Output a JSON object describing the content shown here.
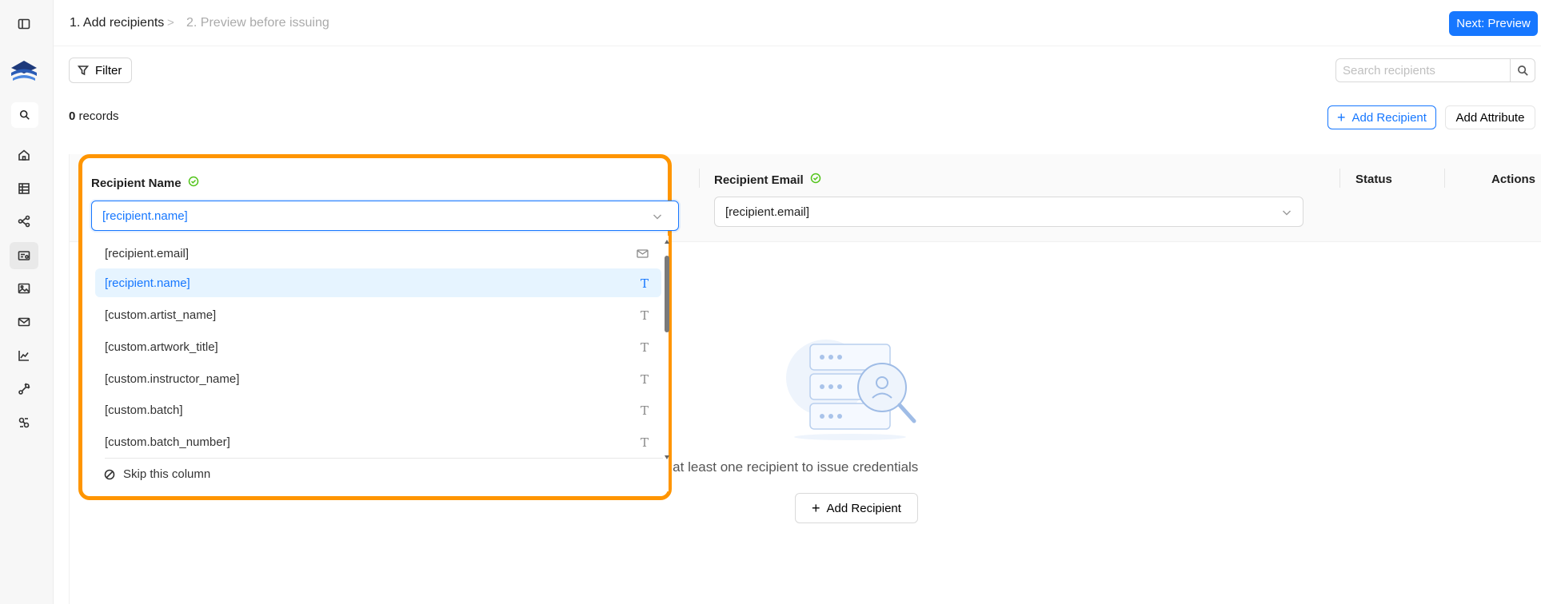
{
  "sidebar": {
    "items": [
      {
        "icon": "sidebar-toggle-icon"
      },
      {
        "icon": "logo-icon"
      },
      {
        "icon": "search-icon"
      },
      {
        "icon": "home-icon"
      },
      {
        "icon": "building-icon"
      },
      {
        "icon": "workflow-icon"
      },
      {
        "icon": "credential-icon",
        "active": true
      },
      {
        "icon": "image-icon"
      },
      {
        "icon": "mail-icon"
      },
      {
        "icon": "chart-icon"
      },
      {
        "icon": "integrations-icon"
      },
      {
        "icon": "settings-icon"
      }
    ]
  },
  "header": {
    "step1": "1. Add recipients",
    "step2": "2. Preview before issuing",
    "next_label": "Next: Preview"
  },
  "toolbar": {
    "filter_label": "Filter",
    "search_placeholder": "Search recipients",
    "records_count": "0",
    "records_label": "records",
    "add_recipient_label": "Add Recipient",
    "add_attribute_label": "Add Attribute"
  },
  "table": {
    "columns": {
      "name": "Recipient Name",
      "email": "Recipient Email",
      "status": "Status",
      "actions": "Actions"
    },
    "name_mapping": "[recipient.name]",
    "email_mapping": "[recipient.email]"
  },
  "dropdown": {
    "options": [
      {
        "label": "[recipient.email]",
        "type": "email"
      },
      {
        "label": "[recipient.name]",
        "type": "text",
        "selected": true
      },
      {
        "label": "[custom.artist_name]",
        "type": "text"
      },
      {
        "label": "[custom.artwork_title]",
        "type": "text"
      },
      {
        "label": "[custom.instructor_name]",
        "type": "text"
      },
      {
        "label": "[custom.batch]",
        "type": "text"
      },
      {
        "label": "[custom.batch_number]",
        "type": "text"
      }
    ],
    "text_type_glyph": "T",
    "skip_label": "Skip this column"
  },
  "empty_state": {
    "text": "d at least one recipient to issue credentials",
    "add_label": "Add Recipient"
  },
  "colors": {
    "accent": "#1677ff",
    "highlight": "#ff9500",
    "success": "#52c41a"
  }
}
